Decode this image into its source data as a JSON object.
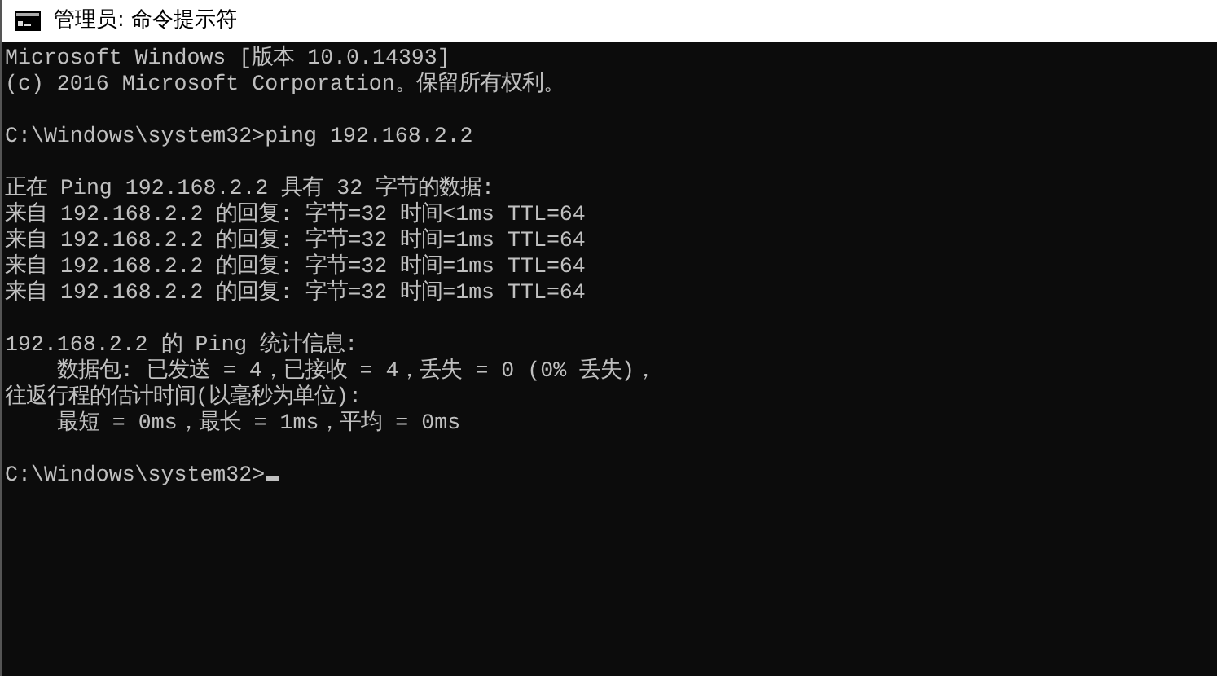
{
  "window": {
    "title": "管理员: 命令提示符"
  },
  "console": {
    "blocks": [
      [
        "Microsoft Windows [版本 10.0.14393]",
        "(c) 2016 Microsoft Corporation。保留所有权利。"
      ],
      [
        "C:\\Windows\\system32>ping 192.168.2.2"
      ],
      [
        "正在 Ping 192.168.2.2 具有 32 字节的数据:",
        "来自 192.168.2.2 的回复: 字节=32 时间<1ms TTL=64",
        "来自 192.168.2.2 的回复: 字节=32 时间=1ms TTL=64",
        "来自 192.168.2.2 的回复: 字节=32 时间=1ms TTL=64",
        "来自 192.168.2.2 的回复: 字节=32 时间=1ms TTL=64"
      ],
      [
        "192.168.2.2 的 Ping 统计信息:",
        "    数据包: 已发送 = 4，已接收 = 4，丢失 = 0 (0% 丢失)，",
        "往返行程的估计时间(以毫秒为单位):",
        "    最短 = 0ms，最长 = 1ms，平均 = 0ms"
      ]
    ],
    "prompt": "C:\\Windows\\system32>"
  }
}
